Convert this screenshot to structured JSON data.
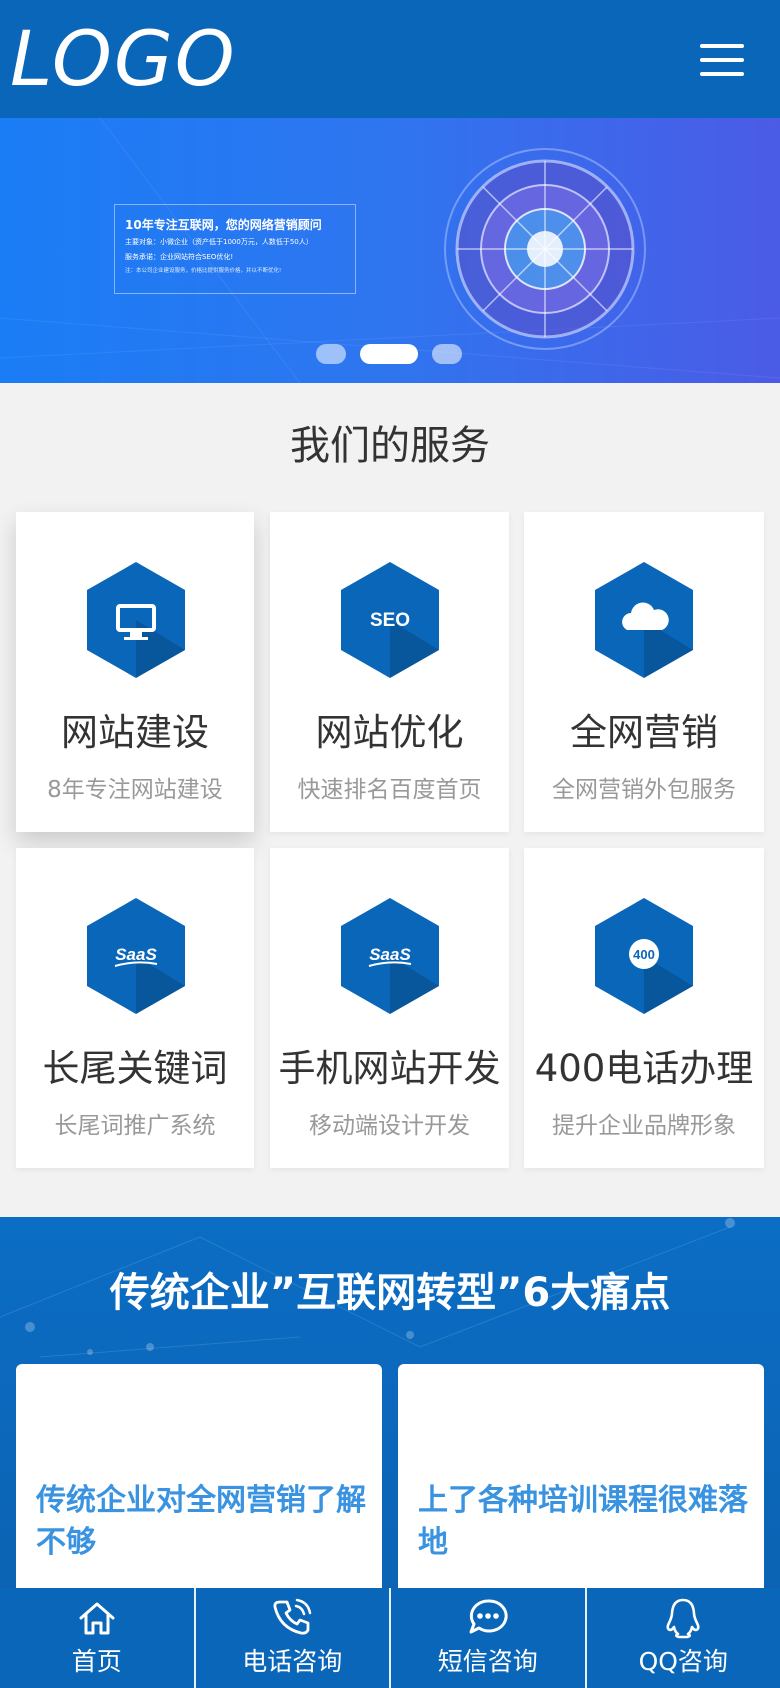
{
  "header": {
    "logo_text": "LOGO",
    "menu_icon": "hamburger-menu-icon"
  },
  "banner": {
    "heading": "10年专注互联网，您的网络营销顾问",
    "line1": "主要对象：小微企业（资产低于1000万元，人数低于50人）",
    "line2": "服务承诺：企业网站符合SEO优化!",
    "note": "注：本公司企业建设服务，价格比提供服务价格，并以不断优化!",
    "slides": 3,
    "active_slide": 2
  },
  "services": {
    "title": "我们的服务",
    "items": [
      {
        "title": "网站建设",
        "subtitle": "8年专注网站建设",
        "icon": "monitor-icon"
      },
      {
        "title": "网站优化",
        "subtitle": "快速排名百度首页",
        "icon": "seo-icon",
        "icon_text": "SEO"
      },
      {
        "title": "全网营销",
        "subtitle": "全网营销外包服务",
        "icon": "cloud-icon"
      },
      {
        "title": "长尾关键词",
        "subtitle": "长尾词推广系统",
        "icon": "saas-icon",
        "icon_text": "SaaS"
      },
      {
        "title": "手机网站开发",
        "subtitle": "移动端设计开发",
        "icon": "saas-icon",
        "icon_text": "SaaS"
      },
      {
        "title": "400电话办理",
        "subtitle": "提升企业品牌形象",
        "icon": "400-phone-icon",
        "icon_text": "400"
      }
    ]
  },
  "pain_points": {
    "title": "传统企业”互联网转型”6大痛点",
    "items": [
      {
        "text": "传统企业对全网营销了解不够"
      },
      {
        "text": "上了各种培训课程很难落地"
      }
    ]
  },
  "bottom_nav": {
    "items": [
      {
        "label": "首页",
        "icon": "home-icon"
      },
      {
        "label": "电话咨询",
        "icon": "phone-icon"
      },
      {
        "label": "短信咨询",
        "icon": "chat-bubble-icon"
      },
      {
        "label": "QQ咨询",
        "icon": "qq-penguin-icon"
      }
    ]
  },
  "colors": {
    "primary": "#0a66b8",
    "accent_text": "#3a93e0",
    "banner_start": "#1a7df5",
    "banner_end": "#4b5be6"
  }
}
